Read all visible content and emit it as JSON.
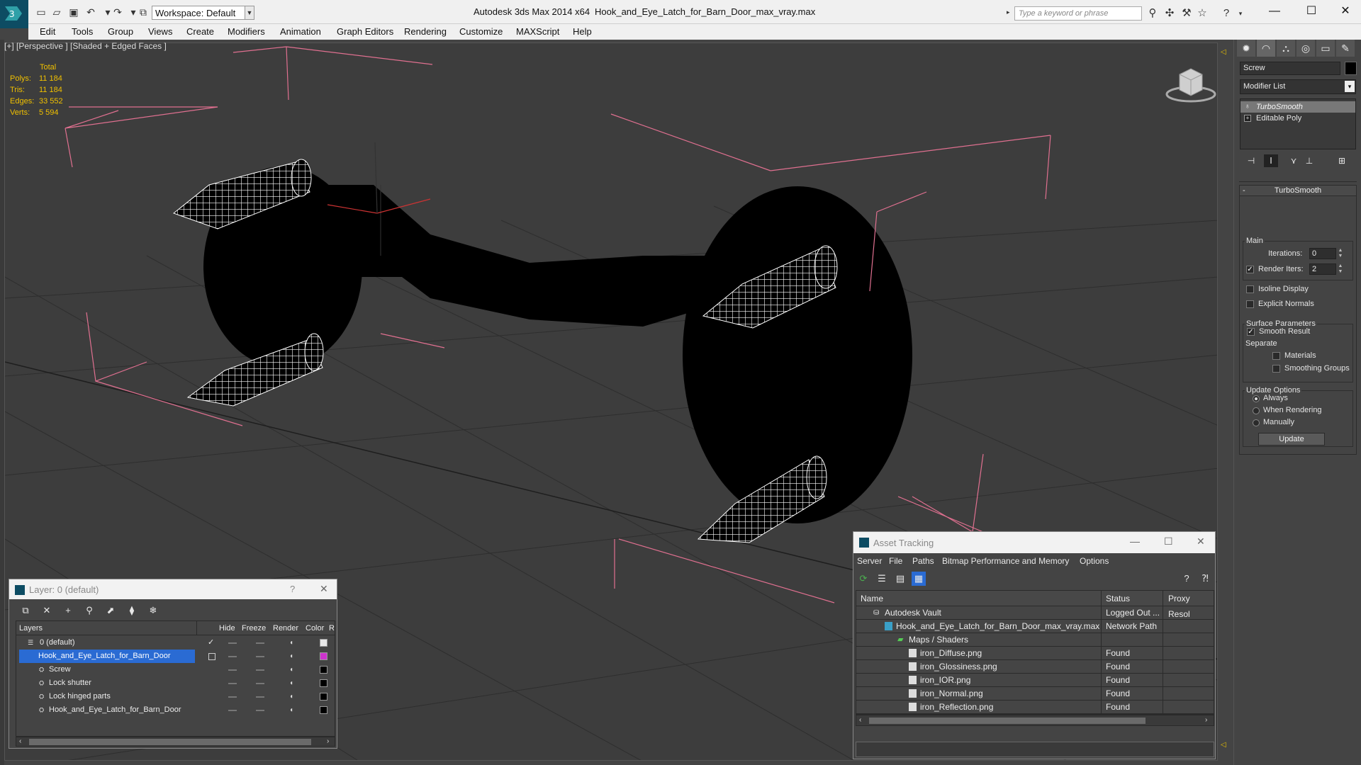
{
  "window": {
    "app_title": "Autodesk 3ds Max  2014 x64",
    "file_title": "Hook_and_Eye_Latch_for_Barn_Door_max_vray.max",
    "workspace": "Workspace: Default",
    "search_placeholder": "Type a keyword or phrase"
  },
  "menu": [
    "Edit",
    "Tools",
    "Group",
    "Views",
    "Create",
    "Modifiers",
    "Animation",
    "Graph Editors",
    "Rendering",
    "Customize",
    "MAXScript",
    "Help"
  ],
  "viewport": {
    "label": "[+] [Perspective ] [Shaded + Edged Faces ]",
    "stats_header": "Total",
    "stats": [
      {
        "label": "Polys:",
        "value": "11 184"
      },
      {
        "label": "Tris:",
        "value": "11 184"
      },
      {
        "label": "Edges:",
        "value": "33 552"
      },
      {
        "label": "Verts:",
        "value": "5 594"
      }
    ]
  },
  "command_panel": {
    "object_name": "Screw",
    "modifier_list": "Modifier List",
    "stack": [
      "TurboSmooth",
      "Editable Poly"
    ],
    "turbosmooth": {
      "title": "TurboSmooth",
      "main_group": "Main",
      "iterations_label": "Iterations:",
      "iterations_value": "0",
      "render_iters_label": "Render Iters:",
      "render_iters_value": "2",
      "isoline": "Isoline Display",
      "explicit_normals": "Explicit Normals",
      "surface_group": "Surface Parameters",
      "smooth_result": "Smooth Result",
      "separate": "Separate",
      "materials": "Materials",
      "smoothing_groups": "Smoothing Groups",
      "update_group": "Update Options",
      "always": "Always",
      "when_rendering": "When Rendering",
      "manually": "Manually",
      "update_button": "Update"
    }
  },
  "layer_dialog": {
    "title": "Layer: 0 (default)",
    "help": "?",
    "columns": [
      "Layers",
      "Hide",
      "Freeze",
      "Render",
      "Color",
      "R"
    ],
    "rows": [
      {
        "name": "0 (default)",
        "color": "#e8e8e8",
        "indent": 1
      },
      {
        "name": "Hook_and_Eye_Latch_for_Barn_Door",
        "color": "#cc33cc",
        "indent": 1
      },
      {
        "name": "Screw",
        "color": "#000000",
        "indent": 2
      },
      {
        "name": "Lock shutter",
        "color": "#000000",
        "indent": 2
      },
      {
        "name": "Lock hinged parts",
        "color": "#000000",
        "indent": 2
      },
      {
        "name": "Hook_and_Eye_Latch_for_Barn_Door",
        "color": "#000000",
        "indent": 2
      }
    ]
  },
  "asset_dialog": {
    "title": "Asset Tracking",
    "menu": [
      "Server",
      "File",
      "Paths",
      "Bitmap Performance and Memory",
      "Options"
    ],
    "columns": [
      "Name",
      "Status",
      "Proxy Resol"
    ],
    "rows": [
      {
        "name": "Autodesk Vault",
        "status": "Logged Out ...",
        "indent": 1
      },
      {
        "name": "Hook_and_Eye_Latch_for_Barn_Door_max_vray.max",
        "status": "Network Path",
        "indent": 2
      },
      {
        "name": "Maps / Shaders",
        "status": "",
        "indent": 3
      },
      {
        "name": "iron_Diffuse.png",
        "status": "Found",
        "indent": 4
      },
      {
        "name": "iron_Glossiness.png",
        "status": "Found",
        "indent": 4
      },
      {
        "name": "iron_IOR.png",
        "status": "Found",
        "indent": 4
      },
      {
        "name": "iron_Normal.png",
        "status": "Found",
        "indent": 4
      },
      {
        "name": "iron_Reflection.png",
        "status": "Found",
        "indent": 4
      }
    ]
  },
  "colors": {
    "selection_blue": "#2a6bd3",
    "bounding_box_pink": "#e07090",
    "stats_yellow": "#f0c000",
    "viewport_bg": "#3d3d3d"
  }
}
